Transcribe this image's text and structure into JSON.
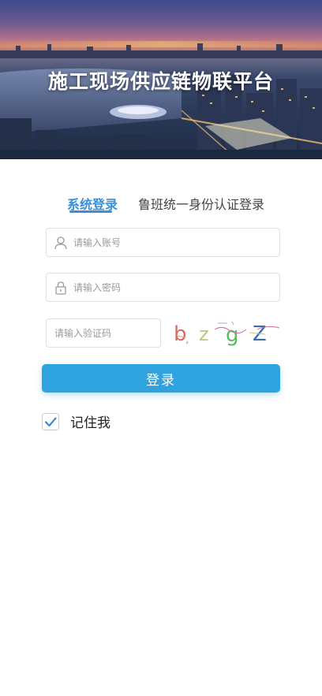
{
  "banner": {
    "title": "施工现场供应链物联平台"
  },
  "tabs": [
    {
      "label": "系统登录",
      "active": true
    },
    {
      "label": "鲁班统一身份认证登录",
      "active": false
    }
  ],
  "form": {
    "account": {
      "placeholder": "请输入账号",
      "value": "",
      "icon": "user-icon"
    },
    "password": {
      "placeholder": "请输入密码",
      "value": "",
      "icon": "lock-icon"
    },
    "captcha": {
      "placeholder": "请输入验证码",
      "value": "",
      "image_text": "b z g Z"
    },
    "submit_label": "登录",
    "remember": {
      "label": "记住我",
      "checked": true
    }
  },
  "colors": {
    "accent": "#3a8fd6",
    "button": "#2fa3df"
  }
}
